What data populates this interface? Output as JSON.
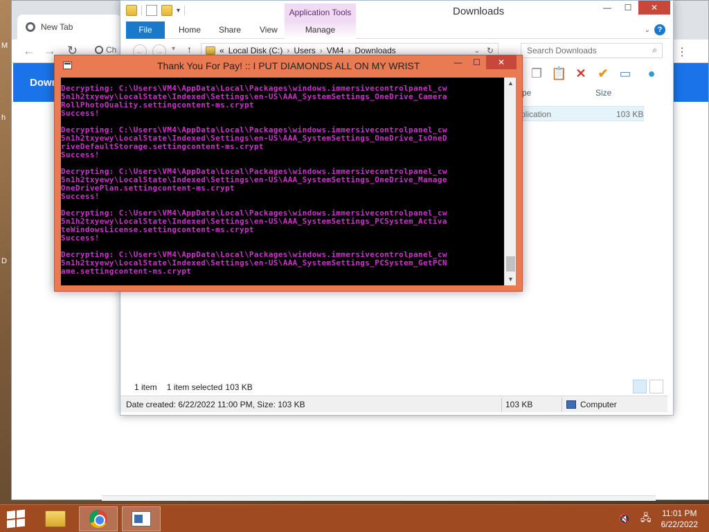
{
  "desktop": {
    "labels": [
      "M",
      "h",
      "D"
    ]
  },
  "chrome": {
    "tab_title": "New Tab",
    "omnibox_partial": "Ch",
    "banner_partial": "Down"
  },
  "explorer": {
    "title": "Downloads",
    "context_tab": "Application Tools",
    "tabs": {
      "file": "File",
      "home": "Home",
      "share": "Share",
      "view": "View",
      "manage": "Manage"
    },
    "path": {
      "overflow": "«",
      "crumbs": [
        "Local Disk (C:)",
        "Users",
        "VM4",
        "Downloads"
      ]
    },
    "search_placeholder": "Search Downloads",
    "columns": {
      "type": "pe",
      "size": "Size"
    },
    "row": {
      "type": "plication",
      "size": "103 KB"
    },
    "status": {
      "count": "1 item",
      "selected": "1 item selected",
      "size": "103 KB"
    },
    "info": {
      "details": "Date created: 6/22/2022 11:00 PM, Size: 103 KB",
      "size": "103 KB",
      "location": "Computer"
    }
  },
  "console": {
    "title": "Thank You For Pay! :: I PUT DIAMONDS ALL ON MY WRIST",
    "blocks": [
      [
        "Decrypting: C:\\Users\\VM4\\AppData\\Local\\Packages\\windows.immersivecontrolpanel_cw",
        "5n1h2txyewy\\LocalState\\Indexed\\Settings\\en-US\\AAA_SystemSettings_OneDrive_Camera",
        "RollPhotoQuality.settingcontent-ms.crypt",
        "Success!"
      ],
      [
        "Decrypting: C:\\Users\\VM4\\AppData\\Local\\Packages\\windows.immersivecontrolpanel_cw",
        "5n1h2txyewy\\LocalState\\Indexed\\Settings\\en-US\\AAA_SystemSettings_OneDrive_IsOneD",
        "riveDefaultStorage.settingcontent-ms.crypt",
        "Success!"
      ],
      [
        "Decrypting: C:\\Users\\VM4\\AppData\\Local\\Packages\\windows.immersivecontrolpanel_cw",
        "5n1h2txyewy\\LocalState\\Indexed\\Settings\\en-US\\AAA_SystemSettings_OneDrive_Manage",
        "OneDrivePlan.settingcontent-ms.crypt",
        "Success!"
      ],
      [
        "Decrypting: C:\\Users\\VM4\\AppData\\Local\\Packages\\windows.immersivecontrolpanel_cw",
        "5n1h2txyewy\\LocalState\\Indexed\\Settings\\en-US\\AAA_SystemSettings_PCSystem_Activa",
        "teWindowsLicense.settingcontent-ms.crypt",
        "Success!"
      ],
      [
        "Decrypting: C:\\Users\\VM4\\AppData\\Local\\Packages\\windows.immersivecontrolpanel_cw",
        "5n1h2txyewy\\LocalState\\Indexed\\Settings\\en-US\\AAA_SystemSettings_PCSystem_GetPCN",
        "ame.settingcontent-ms.crypt"
      ]
    ]
  },
  "taskbar": {
    "time": "11:01 PM",
    "date": "6/22/2022"
  },
  "colors": {
    "console_text": "#cc33cc",
    "console_frame": "#e97a52",
    "taskbar": "#a04a22",
    "ribbon_file": "#1979ca"
  }
}
